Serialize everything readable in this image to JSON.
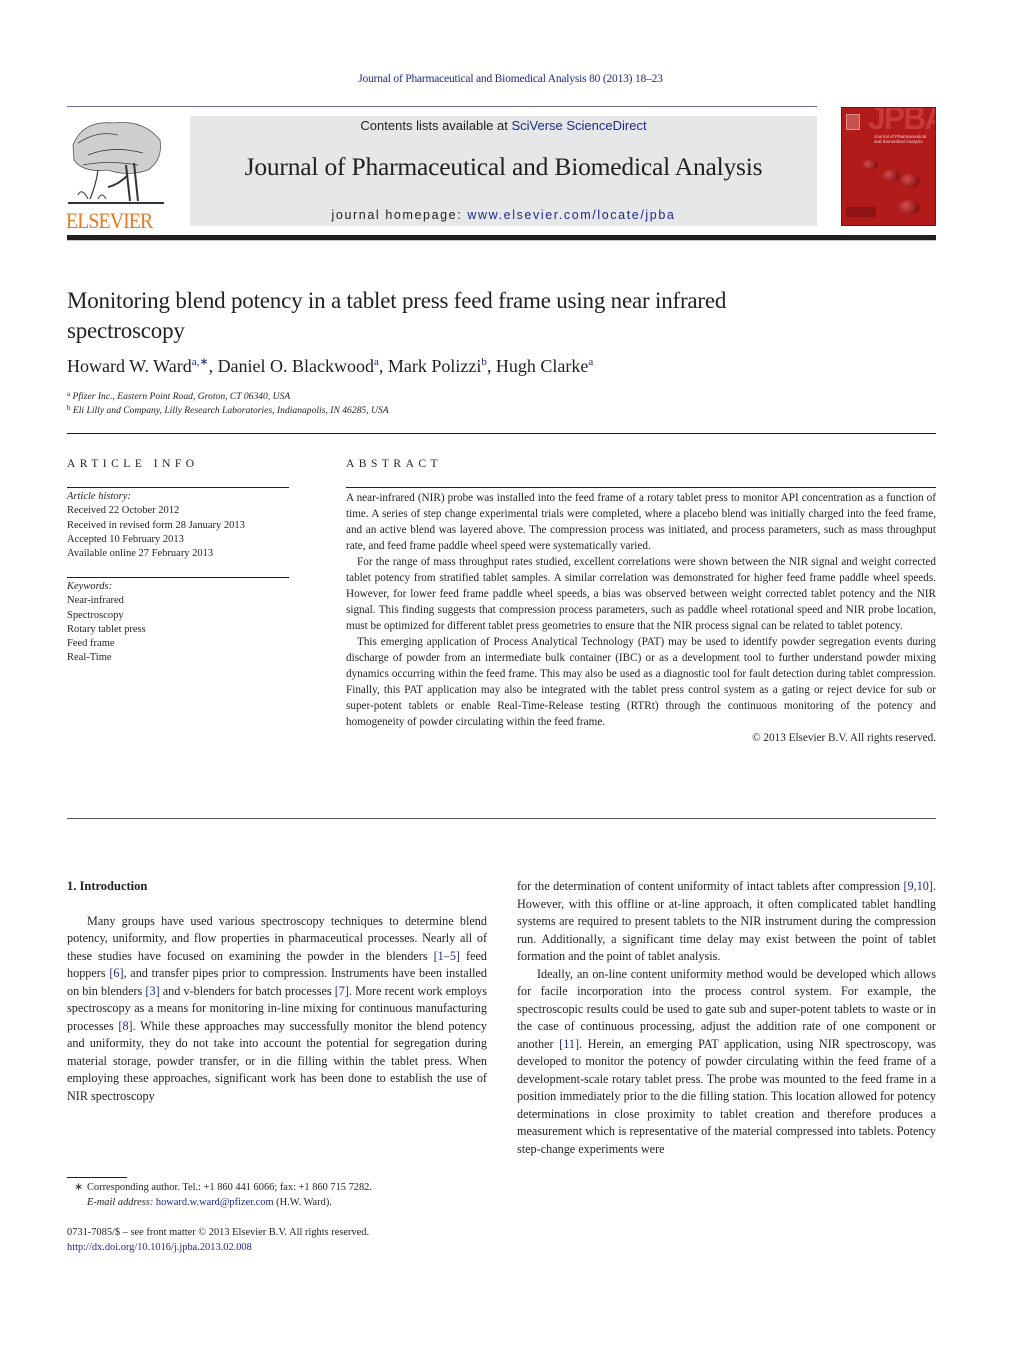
{
  "header": {
    "citation": "Journal of Pharmaceutical and Biomedical Analysis 80 (2013) 18–23",
    "publisher_wordmark": "ELSEVIER",
    "contents_prefix": "Contents lists available at ",
    "contents_link": "SciVerse ScienceDirect",
    "journal_title": "Journal of Pharmaceutical and Biomedical Analysis",
    "homepage_prefix": "journal homepage: ",
    "homepage_url": "www.elsevier.com/locate/jpba",
    "cover": {
      "abbrev": "JPBA",
      "small_title": "Journal of Pharmaceutical and Biomedical Analysis",
      "color": "#b31b1b"
    }
  },
  "article": {
    "title": "Monitoring blend potency in a tablet press feed frame using near infrared spectroscopy",
    "authors": [
      {
        "name": "Howard W. Ward",
        "sup": "a,∗",
        "sep": ", "
      },
      {
        "name": "Daniel O. Blackwood",
        "sup": "a",
        "sep": ", "
      },
      {
        "name": "Mark Polizzi",
        "sup": "b",
        "sep": ", "
      },
      {
        "name": "Hugh Clarke",
        "sup": "a",
        "sep": ""
      }
    ],
    "affiliations": [
      {
        "sup": "a",
        "text": "Pfizer Inc., Eastern Point Road, Groton, CT 06340, USA"
      },
      {
        "sup": "b",
        "text": "Eli Lilly and Company, Lilly Research Laboratories, Indianapolis, IN 46285, USA"
      }
    ]
  },
  "article_info": {
    "heading": "ARTICLE INFO",
    "history_label": "Article history:",
    "history": [
      "Received 22 October 2012",
      "Received in revised form 28 January 2013",
      "Accepted 10 February 2013",
      "Available online 27 February 2013"
    ],
    "keywords_label": "Keywords:",
    "keywords": [
      "Near-infrared",
      "Spectroscopy",
      "Rotary tablet press",
      "Feed frame",
      "Real-Time"
    ]
  },
  "abstract": {
    "heading": "ABSTRACT",
    "paragraphs": [
      "A near-infrared (NIR) probe was installed into the feed frame of a rotary tablet press to monitor API concentration as a function of time. A series of step change experimental trials were completed, where a placebo blend was initially charged into the feed frame, and an active blend was layered above. The compression process was initiated, and process parameters, such as mass throughput rate, and feed frame paddle wheel speed were systematically varied.",
      "For the range of mass throughput rates studied, excellent correlations were shown between the NIR signal and weight corrected tablet potency from stratified tablet samples. A similar correlation was demonstrated for higher feed frame paddle wheel speeds. However, for lower feed frame paddle wheel speeds, a bias was observed between weight corrected tablet potency and the NIR signal. This finding suggests that compression process parameters, such as paddle wheel rotational speed and NIR probe location, must be optimized for different tablet press geometries to ensure that the NIR process signal can be related to tablet potency.",
      "This emerging application of Process Analytical Technology (PAT) may be used to identify powder segregation events during discharge of powder from an intermediate bulk container (IBC) or as a development tool to further understand powder mixing dynamics occurring within the feed frame. This may also be used as a diagnostic tool for fault detection during tablet compression. Finally, this PAT application may also be integrated with the tablet press control system as a gating or reject device for sub or super-potent tablets or enable Real-Time-Release testing (RTRt) through the continuous monitoring of the potency and homogeneity of powder circulating within the feed frame."
    ],
    "copyright": "© 2013 Elsevier B.V. All rights reserved."
  },
  "body": {
    "section_heading": "1.  Introduction",
    "left_paragraph": [
      {
        "t": "Many groups have used various spectroscopy techniques to determine blend potency, uniformity, and flow properties in pharmaceutical processes. Nearly all of these studies have focused on examining the powder in the blenders "
      },
      {
        "ref": "[1–5]"
      },
      {
        "t": " feed hoppers "
      },
      {
        "ref": "[6]"
      },
      {
        "t": ", and transfer pipes prior to compression. Instruments have been installed on bin blenders "
      },
      {
        "ref": "[3]"
      },
      {
        "t": " and v-blenders for batch processes "
      },
      {
        "ref": "[7]"
      },
      {
        "t": ". More recent work employs spectroscopy as a means for monitoring in-line mixing for continuous manufacturing processes "
      },
      {
        "ref": "[8]"
      },
      {
        "t": ". While these approaches may successfully monitor the blend potency and uniformity, they do not take into account the potential for segregation during material storage, powder transfer, or in die filling within the tablet press. When employing these approaches, significant work has been done to establish the use of NIR spectroscopy"
      }
    ],
    "right_paragraph_1": [
      {
        "t": "for the determination of content uniformity of intact tablets after compression "
      },
      {
        "ref": "[9,10]"
      },
      {
        "t": ". However, with this offline or at-line approach, it often complicated tablet handling systems are required to present tablets to the NIR instrument during the compression run. Additionally, a significant time delay may exist between the point of tablet formation and the point of tablet analysis."
      }
    ],
    "right_paragraph_2": [
      {
        "t": "Ideally, an on-line content uniformity method would be developed which allows for facile incorporation into the process control system. For example, the spectroscopic results could be used to gate sub and super-potent tablets to waste or in the case of continuous processing, adjust the addition rate of one component or another "
      },
      {
        "ref": "[11]"
      },
      {
        "t": ". Herein, an emerging PAT application, using NIR spectroscopy, was developed to monitor the potency of powder circulating within the feed frame of a development-scale rotary tablet press. The probe was mounted to the feed frame in a position immediately prior to the die filling station. This location allowed for potency determinations in close proximity to tablet creation and therefore produces a measurement which is representative of the material compressed into tablets. Potency step-change experiments were"
      }
    ]
  },
  "footnotes": {
    "star": "∗",
    "corresponding": "Corresponding author. Tel.: +1 860 441 6066; fax: +1 860 715 7282.",
    "email_label": "E-mail address:",
    "email": "howard.w.ward@pfizer.com",
    "email_suffix": " (H.W. Ward).",
    "issn_line": "0731-7085/$ – see front matter © 2013 Elsevier B.V. All rights reserved.",
    "doi": "http://dx.doi.org/10.1016/j.jpba.2013.02.008"
  }
}
